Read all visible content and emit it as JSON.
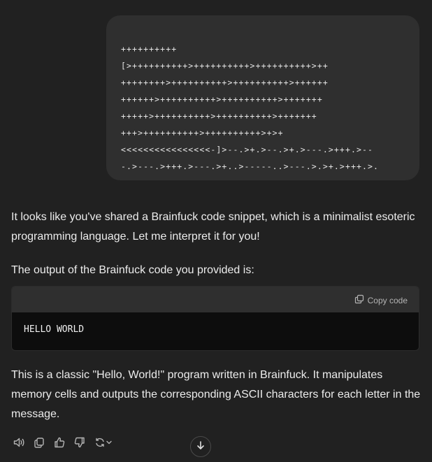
{
  "user_message": {
    "lines": [
      "++++++++++",
      "[>++++++++++>++++++++++>++++++++++>++",
      "++++++++>++++++++++>++++++++++>++++++",
      "++++++>++++++++++>++++++++++>+++++++",
      "+++++>++++++++++>++++++++++>+++++++",
      "+++>++++++++++>++++++++++>+>+",
      "<<<<<<<<<<<<<<<<-]>--.>+.>--.>+.>---.>+++.>--",
      "-.>---.>+++.>---.>+..>-----..>---.>.>+.>+++.>."
    ]
  },
  "assistant": {
    "para1": "It looks like you've shared a Brainfuck code snippet, which is a minimalist esoteric programming language. Let me interpret it for you!",
    "para2": "The output of the Brainfuck code you provided is:",
    "code": {
      "copy_label": "Copy code",
      "content": "HELLO WORLD"
    },
    "para3": "This is a classic \"Hello, World!\" program written in Brainfuck. It manipulates memory cells and outputs the corresponding ASCII characters for each letter in the message."
  },
  "actions": {
    "icons": [
      "speaker-icon",
      "copy-icon",
      "thumbs-up-icon",
      "thumbs-down-icon",
      "regenerate-icon",
      "chevron-down-icon"
    ]
  },
  "colors": {
    "background": "#212121",
    "bubble": "#2f2f2f",
    "code_header": "#2f2f2f",
    "code_body": "#0d0d0d",
    "text": "#ececec",
    "muted": "#b4b4b4"
  }
}
